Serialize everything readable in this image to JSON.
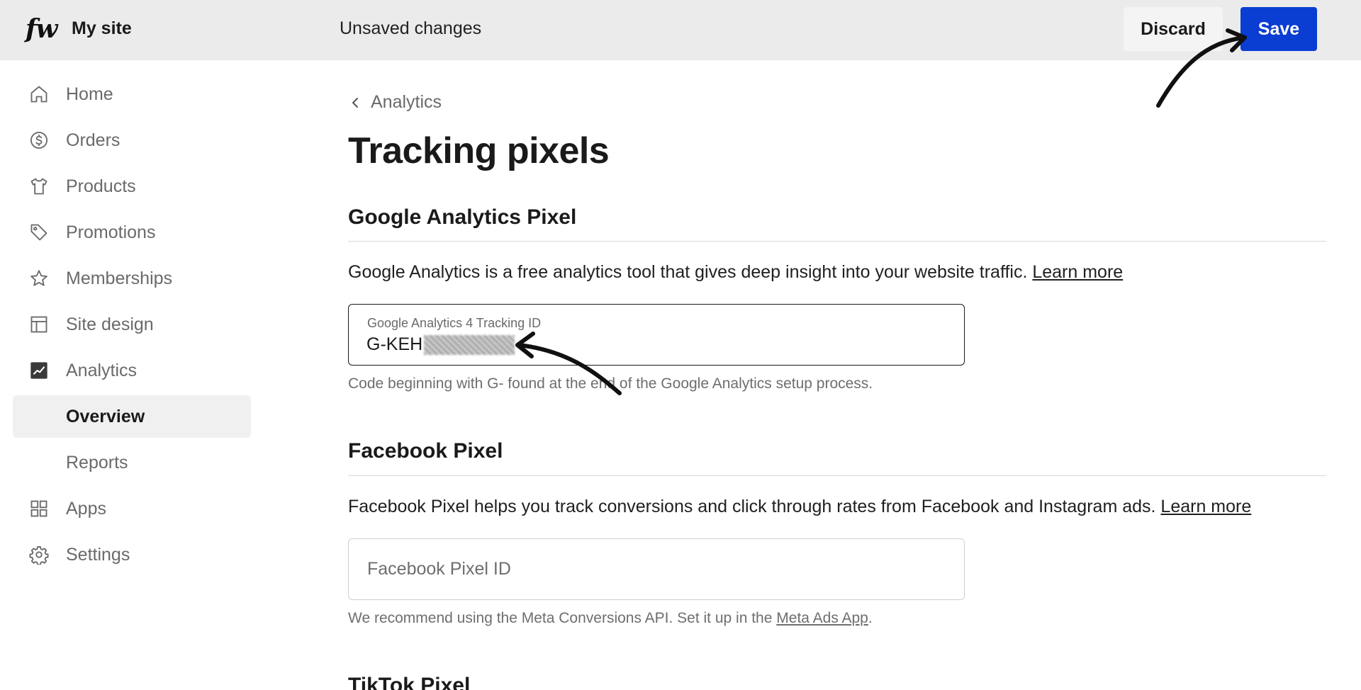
{
  "topbar": {
    "logo": "fw",
    "site_name": "My site",
    "status": "Unsaved changes",
    "discard_label": "Discard",
    "save_label": "Save"
  },
  "sidebar": {
    "items": [
      {
        "label": "Home",
        "icon": "home-icon"
      },
      {
        "label": "Orders",
        "icon": "dollar-circle-icon"
      },
      {
        "label": "Products",
        "icon": "tshirt-icon"
      },
      {
        "label": "Promotions",
        "icon": "tag-icon"
      },
      {
        "label": "Memberships",
        "icon": "star-icon"
      },
      {
        "label": "Site design",
        "icon": "layout-icon"
      },
      {
        "label": "Analytics",
        "icon": "chart-icon"
      },
      {
        "label": "Overview",
        "active": true
      },
      {
        "label": "Reports"
      },
      {
        "label": "Apps",
        "icon": "grid-icon"
      },
      {
        "label": "Settings",
        "icon": "gear-icon"
      }
    ]
  },
  "main": {
    "breadcrumb": "Analytics",
    "title": "Tracking pixels",
    "google": {
      "title": "Google Analytics Pixel",
      "description": "Google Analytics is a free analytics tool that gives deep insight into your website traffic.",
      "learn_more": "Learn more",
      "field_label": "Google Analytics 4 Tracking ID",
      "field_value": "G-KEH",
      "hint": "Code beginning with G- found at the end of the Google Analytics setup process."
    },
    "facebook": {
      "title": "Facebook Pixel",
      "description": "Facebook Pixel helps you track conversions and click through rates from Facebook and Instagram ads.",
      "learn_more": "Learn more",
      "placeholder": "Facebook Pixel ID",
      "hint_prefix": "We recommend using the Meta Conversions API. Set it up in the",
      "hint_link": "Meta Ads App",
      "hint_suffix": "."
    },
    "tiktok": {
      "title": "TikTok Pixel"
    }
  },
  "colors": {
    "topbar_bg": "#ebebeb",
    "save_bg": "#0a3dd1",
    "active_nav_bg": "#f0f0f0"
  }
}
